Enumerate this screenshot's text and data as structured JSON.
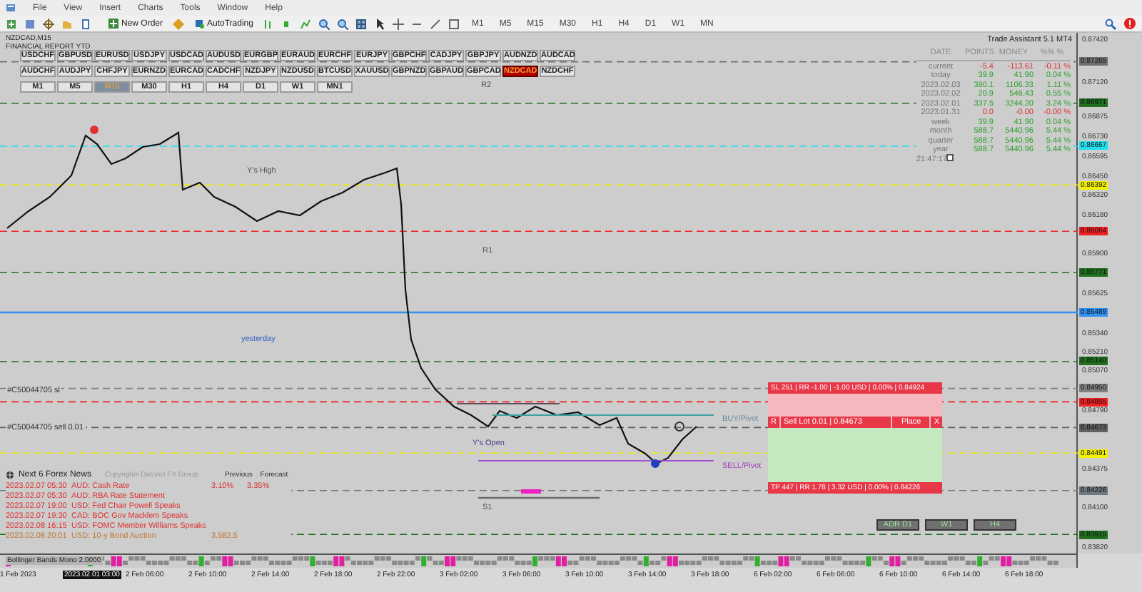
{
  "menu": [
    "File",
    "View",
    "Insert",
    "Charts",
    "Tools",
    "Window",
    "Help"
  ],
  "toolbar": {
    "new_order": "New Order",
    "auto_trading": "AutoTrading",
    "timeframes": [
      "M1",
      "M5",
      "M15",
      "M30",
      "H1",
      "H4",
      "D1",
      "W1",
      "MN"
    ]
  },
  "chart": {
    "title": "NZDCAD,M15",
    "subtitle": "FINANCIAL REPORT YTD",
    "symbol_rows": [
      {
        "buttons": [
          {
            "label": "USDCHF",
            "selected": false
          },
          {
            "label": "GBPUSD",
            "selected": false
          },
          {
            "label": "EURUSD",
            "selected": false
          },
          {
            "label": "USDJPY",
            "selected": false
          },
          {
            "label": "USDCAD",
            "selected": false
          },
          {
            "label": "AUDUSD",
            "selected": false
          },
          {
            "label": "EURGBP",
            "selected": false
          },
          {
            "label": "EURAUD",
            "selected": false
          },
          {
            "label": "EURCHF",
            "selected": false
          },
          {
            "label": "EURJPY",
            "selected": false
          },
          {
            "label": "GBPCHF",
            "selected": false
          },
          {
            "label": "CADJPY",
            "selected": false
          },
          {
            "label": "GBPJPY",
            "selected": false
          },
          {
            "label": "AUDNZD",
            "selected": false
          },
          {
            "label": "AUDCAD",
            "selected": false
          }
        ]
      },
      {
        "buttons": [
          {
            "label": "AUDCHF",
            "selected": false
          },
          {
            "label": "AUDJPY",
            "selected": false
          },
          {
            "label": "CHFJPY",
            "selected": false
          },
          {
            "label": "EURNZD",
            "selected": false
          },
          {
            "label": "EURCAD",
            "selected": false
          },
          {
            "label": "CADCHF",
            "selected": false
          },
          {
            "label": "NZDJPY",
            "selected": false
          },
          {
            "label": "NZDUSD",
            "selected": false
          },
          {
            "label": "BTCUSD",
            "selected": false
          },
          {
            "label": "XAUUSD",
            "selected": false
          },
          {
            "label": "GBPNZD",
            "selected": false
          },
          {
            "label": "GBPAUD",
            "selected": false
          },
          {
            "label": "GBPCAD",
            "selected": false
          },
          {
            "label": "NZDCAD",
            "selected": true
          },
          {
            "label": "NZDCHF",
            "selected": false
          }
        ]
      },
      {
        "buttons": [
          {
            "label": "M1",
            "selected": false
          },
          {
            "label": "M5",
            "selected": false
          },
          {
            "label": "M15",
            "selected": true
          },
          {
            "label": "M30",
            "selected": false
          },
          {
            "label": "H1",
            "selected": false
          },
          {
            "label": "H4",
            "selected": false
          },
          {
            "label": "D1",
            "selected": false
          },
          {
            "label": "W1",
            "selected": false
          },
          {
            "label": "MN1",
            "selected": false
          }
        ]
      }
    ],
    "labels": [
      {
        "text": "R2",
        "color": "#505050"
      },
      {
        "text": "Y's High",
        "color": "#505050"
      },
      {
        "text": "R1",
        "color": "#505050"
      },
      {
        "text": "yesterday",
        "color": "#3060c0"
      },
      {
        "text": "#C50044705 sl",
        "color": "#303030"
      },
      {
        "text": "BUY/Pivot",
        "color": "#6a8aa0"
      },
      {
        "text": "#C50044705 sell 0.01",
        "color": "#303030"
      },
      {
        "text": "Y's Open",
        "color": "#404080"
      },
      {
        "text": "SELL/Pivot",
        "color": "#a040c0"
      },
      {
        "text": "S1",
        "color": "#505050"
      }
    ]
  },
  "trade_assistant": {
    "title": "Trade Assistant 5.1 MT4",
    "columns": [
      "DATE",
      "POINTS",
      "MONEY",
      "%% %"
    ],
    "rows": [
      {
        "label": "current",
        "points": "-5.4",
        "money": "-113.61",
        "percent": "-0.11 %",
        "color": "#e03030"
      },
      {
        "label": "today",
        "points": "39.9",
        "money": "41.90",
        "percent": "0.04 %",
        "color": "#30a030"
      },
      {
        "label": "2023.02.03",
        "points": "390.1",
        "money": "1106.33",
        "percent": "1.11 %",
        "color": "#30a030"
      },
      {
        "label": "2023.02.02",
        "points": "20.9",
        "money": "546.43",
        "percent": "0.55 %",
        "color": "#30a030"
      },
      {
        "label": "2023.02.01",
        "points": "337.5",
        "money": "3244.20",
        "percent": "3.24 %",
        "color": "#30a030"
      },
      {
        "label": "2023.01.31",
        "points": "0.0",
        "money": "-0.00",
        "percent": "-0.00 %",
        "color": "#e03030"
      },
      {
        "label": "week",
        "points": "39.9",
        "money": "41.90",
        "percent": "0.04 %",
        "color": "#30a030"
      },
      {
        "label": "month",
        "points": "588.7",
        "money": "5440.96",
        "percent": "5.44 %",
        "color": "#30a030"
      },
      {
        "label": "quarter",
        "points": "588.7",
        "money": "5440.96",
        "percent": "5.44 %",
        "color": "#30a030"
      },
      {
        "label": "year",
        "points": "588.7",
        "money": "5440.96",
        "percent": "5.44 %",
        "color": "#30a030"
      }
    ],
    "clock": "21:47:17"
  },
  "news": {
    "title": "Next 6 Forex News",
    "copyright": "Copyrights DaVinci FX Group",
    "previous_label": "Previous",
    "forecast_label": "Forecast",
    "rows": [
      {
        "time": "2023.02.07 05:30",
        "event": "AUD: Cash Rate",
        "previous": "3.10%",
        "forecast": "3.35%",
        "color": "#e03030"
      },
      {
        "time": "2023.02.07 05:30",
        "event": "AUD: RBA Rate Statement",
        "color": "#e03030"
      },
      {
        "time": "2023.02.07 19:00",
        "event": "USD: Fed Chair Powell Speaks",
        "color": "#e03030"
      },
      {
        "time": "2023.02.07 19:30",
        "event": "CAD: BOC Gov Macklem Speaks",
        "color": "#e03030"
      },
      {
        "time": "2023.02.08 16:15",
        "event": "USD: FOMC Member Williams Speaks",
        "color": "#e03030"
      },
      {
        "time": "2023.02.08 20:01",
        "event": "USD: 10-y Bond Auction",
        "previous": "3.582.5",
        "color": "#c07830"
      }
    ]
  },
  "order_panel": {
    "sl": "SL 251 | RR -1.00 | -1.00 USD | 0.00% | 0.84924",
    "reverse": "R",
    "sell": "Sell Lot 0.01 | 0.84673",
    "place": "Place",
    "close": "X",
    "tp": "TP 447 | RR 1.78 | 3.32 USD | 0.00% | 0.84226"
  },
  "adr_buttons": [
    "ADR D1",
    "W1",
    "H4"
  ],
  "indicator": "Bollinger Bands Mono 2.0000",
  "price_axis": [
    {
      "text": "0.87420",
      "kind": "tick"
    },
    {
      "text": "0.87265",
      "kind": "marker",
      "color": "#707070"
    },
    {
      "text": "0.87120",
      "kind": "tick"
    },
    {
      "text": "0.86971",
      "kind": "marker",
      "color": "#207020"
    },
    {
      "text": "0.86875",
      "kind": "tick"
    },
    {
      "text": "0.86730",
      "kind": "tick"
    },
    {
      "text": "0.86667",
      "kind": "marker",
      "color": "#20e0f0"
    },
    {
      "text": "0.86595",
      "kind": "tick"
    },
    {
      "text": "0.86450",
      "kind": "tick"
    },
    {
      "text": "0.86392",
      "kind": "marker",
      "color": "#f0f000"
    },
    {
      "text": "0.86320",
      "kind": "tick"
    },
    {
      "text": "0.86180",
      "kind": "tick"
    },
    {
      "text": "0.86064",
      "kind": "marker",
      "color": "#f02020"
    },
    {
      "text": "0.85900",
      "kind": "tick"
    },
    {
      "text": "0.85771",
      "kind": "marker",
      "color": "#207020"
    },
    {
      "text": "0.85625",
      "kind": "tick"
    },
    {
      "text": "0.85489",
      "kind": "marker",
      "color": "#3090f0"
    },
    {
      "text": "0.85340",
      "kind": "tick"
    },
    {
      "text": "0.85210",
      "kind": "tick"
    },
    {
      "text": "0.85140",
      "kind": "marker",
      "color": "#207020"
    },
    {
      "text": "0.85070",
      "kind": "tick"
    },
    {
      "text": "0.84950",
      "kind": "marker",
      "color": "#808080"
    },
    {
      "text": "0.84855",
      "kind": "marker",
      "color": "#f02020"
    },
    {
      "text": "0.84790",
      "kind": "tick"
    },
    {
      "text": "0.84673",
      "kind": "marker",
      "color": "#606060"
    },
    {
      "text": "0.84491",
      "kind": "marker",
      "color": "#f0f000"
    },
    {
      "text": "0.84375",
      "kind": "tick"
    },
    {
      "text": "0.84226",
      "kind": "marker",
      "color": "#707880"
    },
    {
      "text": "0.84100",
      "kind": "tick"
    },
    {
      "text": "0.83915",
      "kind": "marker",
      "color": "#207020"
    },
    {
      "text": "0.83820",
      "kind": "tick"
    }
  ],
  "time_axis": [
    {
      "text": "1 Feb 2023",
      "kind": "tick"
    },
    {
      "text": "2023.02.01 03:00",
      "kind": "marker"
    },
    {
      "text": "2 Feb 06:00",
      "kind": "tick"
    },
    {
      "text": "2 Feb 10:00",
      "kind": "tick"
    },
    {
      "text": "2 Feb 14:00",
      "kind": "tick"
    },
    {
      "text": "2 Feb 18:00",
      "kind": "tick"
    },
    {
      "text": "2 Feb 22:00",
      "kind": "tick"
    },
    {
      "text": "3 Feb 02:00",
      "kind": "tick"
    },
    {
      "text": "3 Feb 06:00",
      "kind": "tick"
    },
    {
      "text": "3 Feb 10:00",
      "kind": "tick"
    },
    {
      "text": "3 Feb 14:00",
      "kind": "tick"
    },
    {
      "text": "3 Feb 18:00",
      "kind": "tick"
    },
    {
      "text": "6 Feb 02:00",
      "kind": "tick"
    },
    {
      "text": "6 Feb 06:00",
      "kind": "tick"
    },
    {
      "text": "6 Feb 10:00",
      "kind": "tick"
    },
    {
      "text": "6 Feb 14:00",
      "kind": "tick"
    },
    {
      "text": "6 Feb 18:00",
      "kind": "tick"
    }
  ]
}
